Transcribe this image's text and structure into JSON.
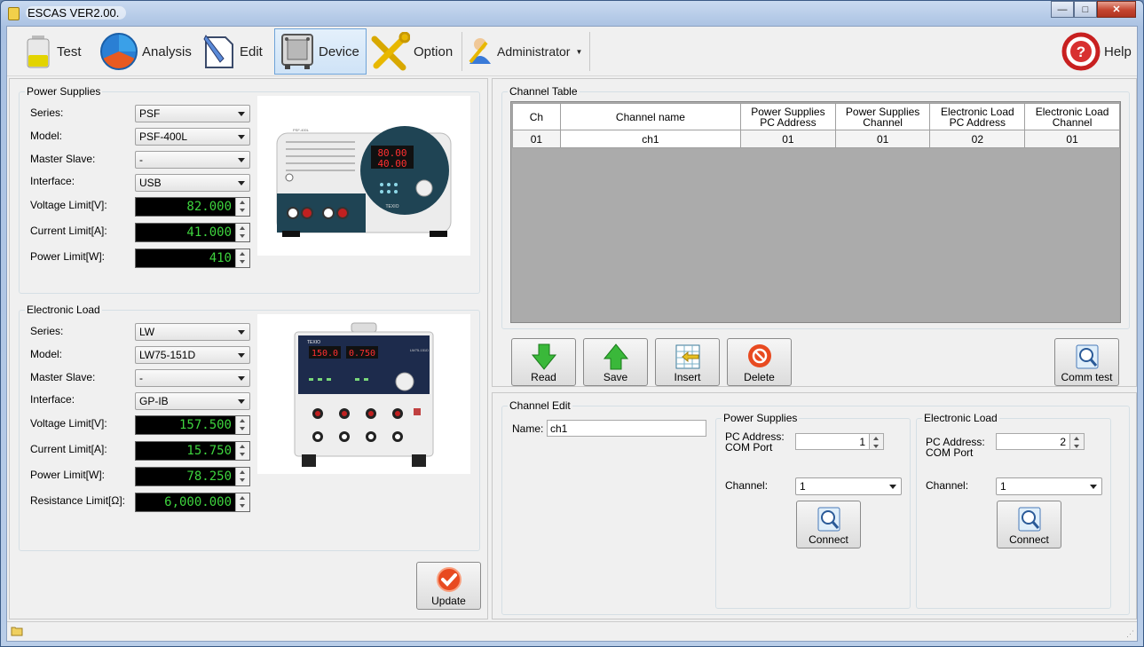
{
  "window": {
    "title": "ESCAS VER2.00."
  },
  "toolbar": {
    "test": "Test",
    "analysis": "Analysis",
    "edit": "Edit",
    "device": "Device",
    "option": "Option",
    "administrator": "Administrator",
    "help": "Help",
    "active": "Device"
  },
  "power_supplies": {
    "title": "Power Supplies",
    "series_label": "Series:",
    "series": "PSF",
    "model_label": "Model:",
    "model": "PSF-400L",
    "master_slave_label": "Master Slave:",
    "master_slave": "-",
    "interface_label": "Interface:",
    "interface": "USB",
    "voltage_label": "Voltage Limit[V]:",
    "voltage": "82.000",
    "current_label": "Current Limit[A]:",
    "current": "41.000",
    "power_label": "Power Limit[W]:",
    "power": "410",
    "device_display": {
      "top": "80.00",
      "bottom": "40.00",
      "brand": "TEXIO",
      "model_tag": "PSF-400L"
    }
  },
  "electronic_load": {
    "title": "Electronic Load",
    "series_label": "Series:",
    "series": "LW",
    "model_label": "Model:",
    "model": "LW75-151D",
    "master_slave_label": "Master Slave:",
    "master_slave": "-",
    "interface_label": "Interface:",
    "interface": "GP-IB",
    "voltage_label": "Voltage Limit[V]:",
    "voltage": "157.500",
    "current_label": "Current Limit[A]:",
    "current": "15.750",
    "power_label": "Power Limit[W]:",
    "power": "78.250",
    "resistance_label": "Resistance Limit[Ω]:",
    "resistance": "6,000.000",
    "device_display": {
      "left": "150.0",
      "right": "0.750",
      "brand": "TEXIO",
      "model_tag": "LW75-151D"
    }
  },
  "update_button": "Update",
  "channel_table": {
    "title": "Channel Table",
    "headers": [
      "Ch",
      "Channel name",
      "Power Supplies\nPC Address",
      "Power Supplies\nChannel",
      "Electronic Load\nPC Address",
      "Electronic Load\nChannel"
    ],
    "rows": [
      [
        "01",
        "ch1",
        "01",
        "01",
        "02",
        "01"
      ]
    ]
  },
  "actions": {
    "read": "Read",
    "save": "Save",
    "insert": "Insert",
    "delete": "Delete",
    "comm_test": "Comm test"
  },
  "channel_edit": {
    "title": "Channel Edit",
    "name_label": "Name:",
    "name": "ch1",
    "ps": {
      "title": "Power Supplies",
      "address_label": "PC Address:\nCOM Port",
      "address": "1",
      "channel_label": "Channel:",
      "channel": "1",
      "connect": "Connect"
    },
    "el": {
      "title": "Electronic Load",
      "address_label": "PC Address:\nCOM Port",
      "address": "2",
      "channel_label": "Channel:",
      "channel": "1",
      "connect": "Connect"
    }
  },
  "colors": {
    "accent_blue": "#6ea3d8",
    "display_green": "#3ed43e",
    "table_bg": "#ababab",
    "title_gradient": "#a9c1e2"
  }
}
